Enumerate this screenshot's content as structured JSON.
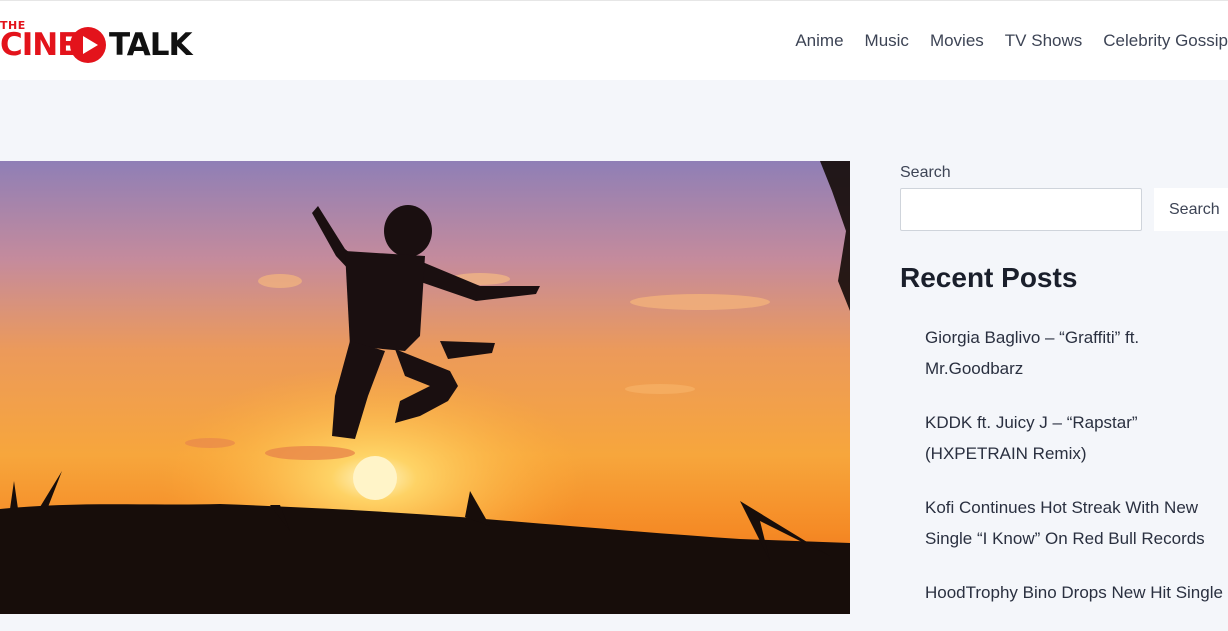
{
  "header": {
    "logo": {
      "the": "THE",
      "cine": "CINE",
      "talk": "TALK"
    },
    "nav": [
      "Anime",
      "Music",
      "Movies",
      "TV Shows",
      "Celebrity Gossip"
    ]
  },
  "hero": {
    "icon": "hero-photo"
  },
  "sidebar": {
    "search_label": "Search",
    "search_value": "",
    "search_button": "Search",
    "recent_title": "Recent Posts",
    "posts": [
      "Giorgia Baglivo – “Graffiti” ft. Mr.Goodbarz",
      "KDDK ft. Juicy J – “Rapstar” (HXPETRAIN Remix)",
      "Kofi Continues Hot Streak With New Single “I Know” On Red Bull Records",
      "HoodTrophy Bino Drops New Hit Single"
    ]
  },
  "colors": {
    "brand_red": "#e3131b",
    "page_bg": "#f4f6fa",
    "text": "#3d4455"
  }
}
